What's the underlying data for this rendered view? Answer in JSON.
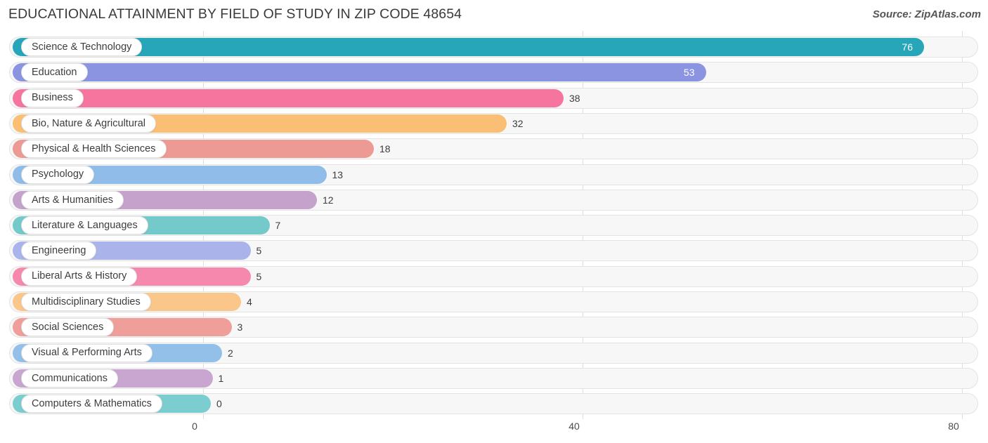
{
  "header": {
    "title": "EDUCATIONAL ATTAINMENT BY FIELD OF STUDY IN ZIP CODE 48654",
    "source": "Source: ZipAtlas.com"
  },
  "chart_data": {
    "type": "bar",
    "orientation": "horizontal",
    "title": "EDUCATIONAL ATTAINMENT BY FIELD OF STUDY IN ZIP CODE 48654",
    "subtitle": "",
    "xlabel": "",
    "ylabel": "",
    "xlim": [
      0,
      80
    ],
    "ylim": null,
    "grid": true,
    "legend": false,
    "xticks": [
      "0",
      "40",
      "80"
    ],
    "xtick_values": [
      0,
      40,
      80
    ],
    "categories": [
      "Science & Technology",
      "Education",
      "Business",
      "Bio, Nature & Agricultural",
      "Physical & Health Sciences",
      "Psychology",
      "Arts & Humanities",
      "Literature & Languages",
      "Engineering",
      "Liberal Arts & History",
      "Multidisciplinary Studies",
      "Social Sciences",
      "Visual & Performing Arts",
      "Communications",
      "Computers & Mathematics"
    ],
    "values": [
      76,
      53,
      38,
      32,
      18,
      13,
      12,
      7,
      5,
      5,
      4,
      3,
      2,
      1,
      0
    ],
    "value_labels": [
      "76",
      "53",
      "38",
      "32",
      "18",
      "13",
      "12",
      "7",
      "5",
      "5",
      "4",
      "3",
      "2",
      "1",
      "0"
    ],
    "colors": [
      "#26a6b8",
      "#8b94e0",
      "#f5759e",
      "#fabe74",
      "#ed9a95",
      "#8fbce8",
      "#c5a2cb",
      "#74c9cb",
      "#aab4ea",
      "#f788ad",
      "#fbc68a",
      "#ef9e99",
      "#93c0e8",
      "#c8a6cf",
      "#7ccdcf"
    ]
  },
  "axis": {
    "ticks": [
      {
        "label": "0",
        "value": 0
      },
      {
        "label": "40",
        "value": 40
      },
      {
        "label": "80",
        "value": 80
      }
    ]
  },
  "style": {
    "track_fill": "#f7f7f7",
    "track_border": "#e3e3e3",
    "gridline": "#dedede",
    "label_pill_bg": "#ffffff",
    "text": "#3d3d3d"
  }
}
